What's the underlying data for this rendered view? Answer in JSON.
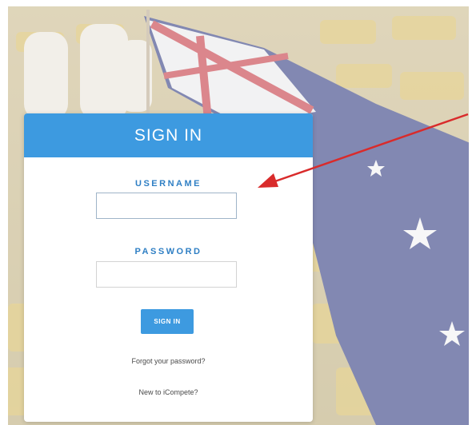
{
  "signin": {
    "title": "SIGN IN",
    "username_label": "USERNAME",
    "password_label": "PASSWORD",
    "username_value": "",
    "password_value": "",
    "submit_label": "SIGN IN",
    "forgot_link": "Forgot your password?",
    "new_link": "New to iCompete?"
  },
  "colors": {
    "accent": "#3d9ae0",
    "label": "#2f7fc4",
    "arrow": "#d92b2b"
  },
  "icons": [
    "annotation-arrow"
  ]
}
